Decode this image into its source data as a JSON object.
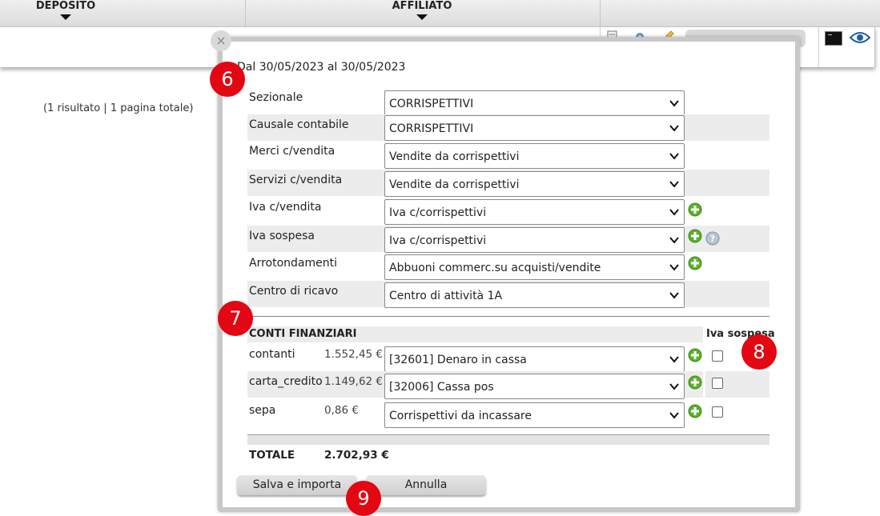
{
  "background": {
    "columns": {
      "deposito": "DEPOSITO",
      "affiliato": "AFFILIATO"
    },
    "results_text": "(1 risultato | 1 pagina totale)"
  },
  "modal": {
    "close_glyph": "×",
    "date_range": "Dal 30/05/2023 al 30/05/2023",
    "fields": [
      {
        "label": "Sezionale",
        "value": "CORRISPETTIVI"
      },
      {
        "label": "Causale contabile",
        "value": "CORRISPETTIVI"
      },
      {
        "label": "Merci c/vendita",
        "value": "Vendite da corrispettivi"
      },
      {
        "label": "Servizi c/vendita",
        "value": "Vendite da corrispettivi"
      },
      {
        "label": "Iva c/vendita",
        "value": "Iva c/corrispettivi"
      },
      {
        "label": "Iva sospesa",
        "value": "Iva c/corrispettivi"
      },
      {
        "label": "Arrotondamenti",
        "value": "Abbuoni commerc.su acquisti/vendite"
      },
      {
        "label": "Centro di ricavo",
        "value": "Centro di attività 1A"
      }
    ],
    "conti_finanziari": {
      "title": "CONTI FINANZIARI",
      "iva_sospesa_header": "Iva sospesa",
      "rows": [
        {
          "name": "contanti",
          "amount": "1.552,45 €",
          "account": "[32601] Denaro in cassa",
          "iva_sospesa": false
        },
        {
          "name": "carta_credito",
          "amount": "1.149,62 €",
          "account": "[32006] Cassa pos",
          "iva_sospesa": false
        },
        {
          "name": "sepa",
          "amount": "0,86 €",
          "account": "Corrispettivi da incassare",
          "iva_sospesa": false
        }
      ]
    },
    "totale_label": "TOTALE",
    "totale_value": "2.702,93 €",
    "buttons": {
      "save": "Salva e importa",
      "cancel": "Annulla"
    }
  },
  "annotations": [
    "6",
    "7",
    "8",
    "9"
  ],
  "colors": {
    "badge": "#e30613",
    "plus_icon": "#5cb02c",
    "band": "#ececec"
  }
}
